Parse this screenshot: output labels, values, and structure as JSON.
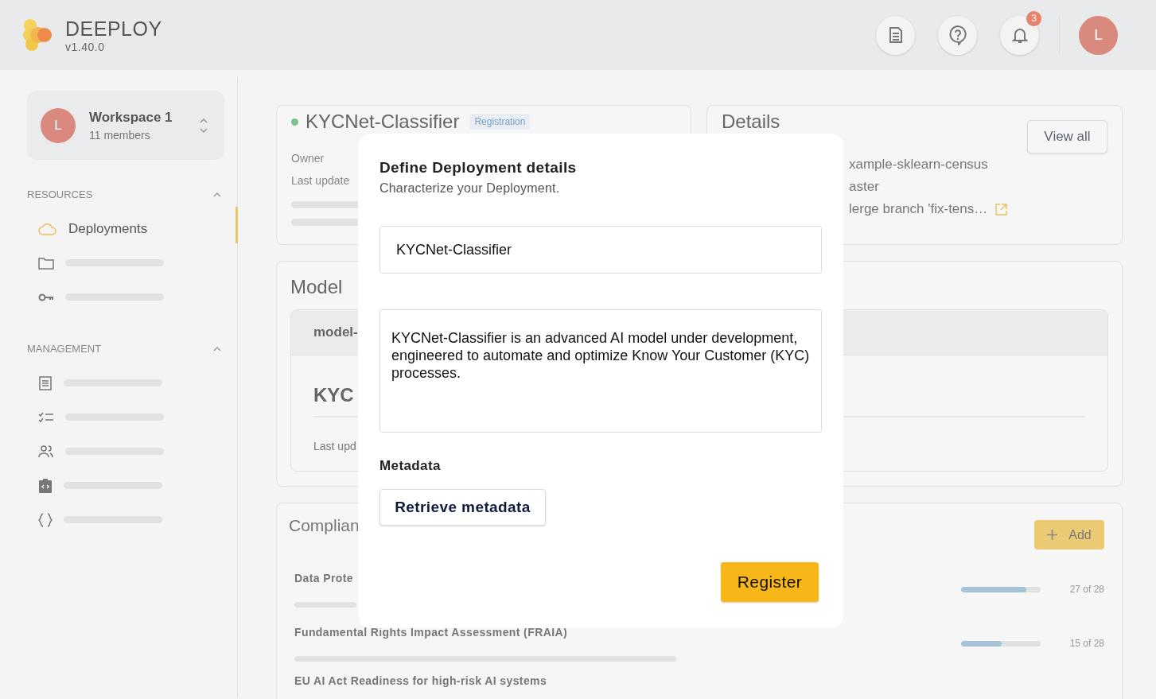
{
  "app": {
    "name": "DEEPLOY",
    "version": "v1.40.0"
  },
  "header": {
    "notification_count": "3",
    "avatar": "L"
  },
  "workspace": {
    "avatar": "L",
    "name": "Workspace 1",
    "members": "11 members"
  },
  "sidebar": {
    "sections": [
      {
        "title": "RESOURCES",
        "expanded": true,
        "items": [
          {
            "kind": "cloud",
            "label": "Deployments",
            "selected": true
          },
          {
            "kind": "folder",
            "selected": false
          },
          {
            "kind": "key",
            "selected": false
          }
        ]
      },
      {
        "title": "MANAGEMENT",
        "expanded": true,
        "items": [
          {
            "kind": "doc",
            "selected": false
          },
          {
            "kind": "checklist",
            "selected": false
          },
          {
            "kind": "people",
            "selected": false
          },
          {
            "kind": "clipboard",
            "selected": false
          },
          {
            "kind": "braces",
            "selected": false
          }
        ]
      }
    ]
  },
  "overview_card": {
    "title": "KYCNet-Classifier",
    "badge": "Registration",
    "fields": [
      "Owner",
      "Last update"
    ]
  },
  "details_card": {
    "title": "Details",
    "button": "View all",
    "values": [
      {
        "text": "xample-sklearn-census",
        "link": false
      },
      {
        "text": "aster",
        "link": false
      },
      {
        "text": "lerge branch 'fix-tens…",
        "link": true
      }
    ]
  },
  "model_card": {
    "title": "Model",
    "header": "model-",
    "name": "KYC",
    "meta": "Last upd"
  },
  "compliance_card": {
    "title": "Complian",
    "add_button": "Add",
    "rows": [
      {
        "title": "Data Prote",
        "level": 0.82,
        "count": "27 of 28"
      },
      {
        "title": "Fundamental Rights Impact Assessment (FRAIA)",
        "level": 0.51,
        "count": "15 of 28"
      },
      {
        "title": "EU AI Act Readiness for high-risk AI systems"
      }
    ]
  },
  "dialog": {
    "title": "Define Deployment details",
    "subtitle": "Characterize your Deployment.",
    "name_value": "KYCNet-Classifier",
    "description_value": "KYCNet-Classifier is an advanced AI model under development, engineered to automate and optimize Know Your Customer (KYC) processes.",
    "metadata_label": "Metadata",
    "retrieve_button": "Retrieve metadata",
    "submit_button": "Register"
  }
}
